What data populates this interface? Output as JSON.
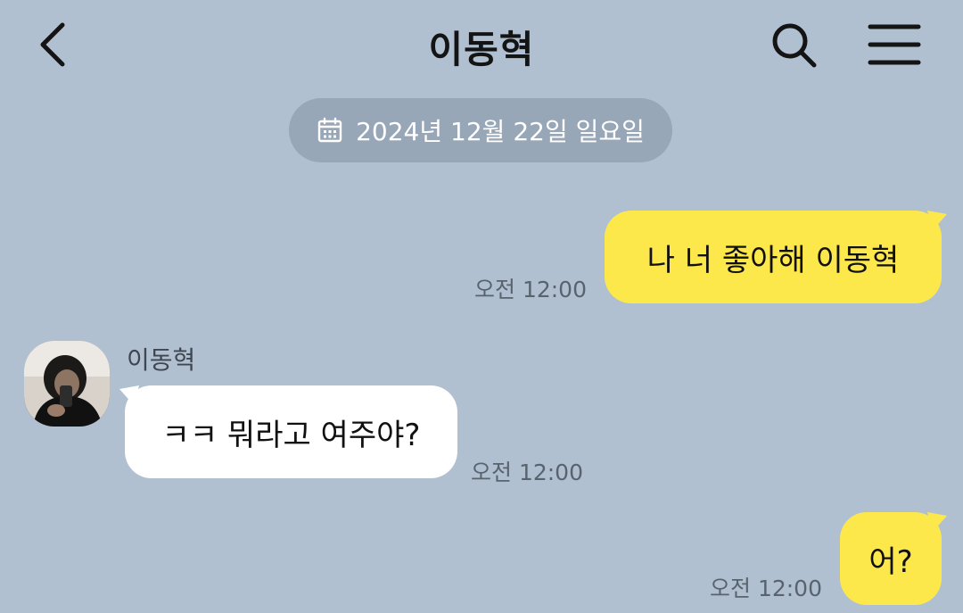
{
  "header": {
    "title": "이동혁",
    "back_icon": "chevron-left-icon",
    "search_icon": "search-icon",
    "menu_icon": "hamburger-menu-icon"
  },
  "date_divider": {
    "icon": "calendar-icon",
    "text": "2024년 12월 22일 일요일"
  },
  "messages": [
    {
      "from": "me",
      "text": "나 너 좋아해 이동혁",
      "time": "오전 12:00"
    },
    {
      "from": "other",
      "sender": "이동혁",
      "avatar": "profile-photo",
      "text": "ㅋㅋ 뭐라고 여주야?",
      "time": "오전 12:00"
    },
    {
      "from": "me",
      "text": "어?",
      "time": "오전 12:00"
    }
  ],
  "colors": {
    "background": "#b1c0d1",
    "my_bubble": "#fde84c",
    "other_bubble": "#ffffff",
    "date_pill": "#98a7b7"
  }
}
